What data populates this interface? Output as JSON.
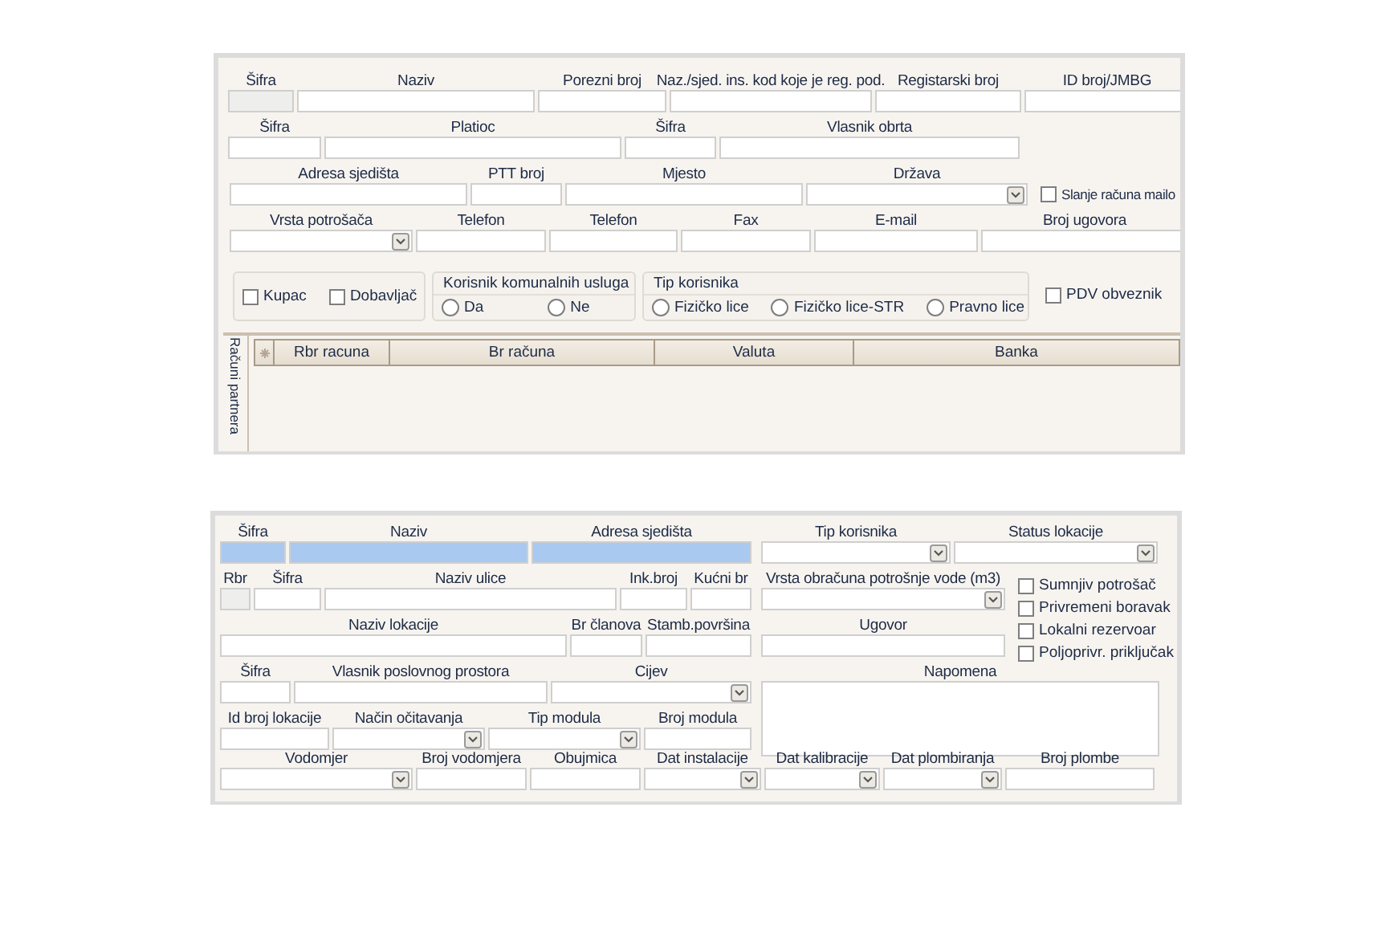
{
  "partner_form": {
    "lines": [
      {
        "fields": [
          {
            "kind": "text",
            "label": "Šifra",
            "disabled": true
          },
          {
            "kind": "text",
            "label": "Naziv",
            "disabled": false
          },
          {
            "kind": "text",
            "label": "Porezni broj",
            "disabled": false
          },
          {
            "kind": "text",
            "label": "Naz./sjed. ins. kod koje je reg. pod.",
            "disabled": false
          },
          {
            "kind": "text",
            "label": "Registarski broj",
            "disabled": false
          },
          {
            "kind": "text",
            "label": "ID broj/JMBG",
            "disabled": false
          }
        ]
      },
      {
        "fields": [
          {
            "kind": "text",
            "label": "Šifra",
            "disabled": false
          },
          {
            "kind": "text",
            "label": "Platioc",
            "disabled": false
          },
          {
            "kind": "text",
            "label": "Šifra",
            "disabled": false
          },
          {
            "kind": "text",
            "label": "Vlasnik obrta",
            "disabled": false
          }
        ]
      },
      {
        "fields": [
          {
            "kind": "text",
            "label": "Adresa sjedišta",
            "disabled": false
          },
          {
            "kind": "text",
            "label": "PTT broj",
            "disabled": false
          },
          {
            "kind": "text",
            "label": "Mjesto",
            "disabled": false
          },
          {
            "kind": "select",
            "label": "Država"
          }
        ],
        "checkbox": {
          "label": "Slanje računa mailo",
          "checked": false
        }
      },
      {
        "fields": [
          {
            "kind": "select",
            "label": "Vrsta potrošača"
          },
          {
            "kind": "text",
            "label": "Telefon",
            "disabled": false
          },
          {
            "kind": "text",
            "label": "Telefon",
            "disabled": false
          },
          {
            "kind": "text",
            "label": "Fax",
            "disabled": false
          },
          {
            "kind": "text",
            "label": "E-mail",
            "disabled": false
          },
          {
            "kind": "text",
            "label": "Broj ugovora",
            "disabled": false
          }
        ]
      }
    ],
    "roles": [
      {
        "label": "Kupac",
        "checked": false
      },
      {
        "label": "Dobavljač",
        "checked": false
      }
    ],
    "utility_user": {
      "title": "Korisnik komunalnih usluga",
      "options": [
        {
          "label": "Da",
          "selected": false
        },
        {
          "label": "Ne",
          "selected": false
        }
      ]
    },
    "user_type": {
      "title": "Tip korisnika",
      "options": [
        {
          "label": "Fizičko lice",
          "selected": false
        },
        {
          "label": "Fizičko lice-STR",
          "selected": false
        },
        {
          "label": "Pravno lice",
          "selected": false
        }
      ]
    },
    "vat": {
      "label": "PDV obveznik",
      "checked": false
    },
    "accounts": {
      "tab": "Računi partnera",
      "columns": [
        "Rbr racuna",
        "Br računa",
        "Valuta",
        "Banka"
      ]
    }
  },
  "location_form": {
    "left_lines": [
      {
        "fields": [
          {
            "kind": "text",
            "label": "Šifra",
            "disabled": false,
            "highlighted": true
          },
          {
            "kind": "text",
            "label": "Naziv",
            "disabled": false,
            "highlighted": true
          },
          {
            "kind": "text",
            "label": "Adresa sjedišta",
            "disabled": false,
            "highlighted": true
          }
        ]
      },
      {
        "fields": [
          {
            "kind": "text",
            "label": "Rbr",
            "disabled": true,
            "highlighted": false
          },
          {
            "kind": "text",
            "label": "Šifra",
            "disabled": false,
            "highlighted": false
          },
          {
            "kind": "text",
            "label": "Naziv ulice",
            "disabled": false,
            "highlighted": false
          },
          {
            "kind": "text",
            "label": "Ink.broj",
            "disabled": false,
            "highlighted": false
          },
          {
            "kind": "text",
            "label": "Kućni br",
            "disabled": false,
            "highlighted": false
          }
        ]
      },
      {
        "fields": [
          {
            "kind": "text",
            "label": "Naziv  lokacije",
            "disabled": false,
            "highlighted": false
          },
          {
            "kind": "text",
            "label": "Br članova",
            "disabled": false,
            "highlighted": false
          },
          {
            "kind": "text",
            "label": "Stamb.površina",
            "disabled": false,
            "highlighted": false
          }
        ]
      },
      {
        "fields": [
          {
            "kind": "text",
            "label": "Šifra",
            "disabled": false,
            "highlighted": false
          },
          {
            "kind": "text",
            "label": "Vlasnik poslovnog prostora",
            "disabled": false,
            "highlighted": false
          },
          {
            "kind": "select",
            "label": "Cijev"
          }
        ]
      },
      {
        "fields": [
          {
            "kind": "text",
            "label": "Id broj lokacije",
            "disabled": false,
            "highlighted": false
          },
          {
            "kind": "select",
            "label": "Način očitavanja"
          },
          {
            "kind": "select",
            "label": "Tip modula"
          },
          {
            "kind": "text",
            "label": "Broj modula",
            "disabled": false,
            "highlighted": false
          }
        ]
      }
    ],
    "right_top": [
      {
        "kind": "select",
        "label": "Tip korisnika"
      },
      {
        "kind": "select",
        "label": "Status lokacije"
      }
    ],
    "right_fields": [
      {
        "kind": "select",
        "label": "Vrsta obračuna potrošnje vode (m3)"
      },
      {
        "kind": "text",
        "label": "Ugovor",
        "disabled": false,
        "highlighted": false
      }
    ],
    "flags": [
      {
        "label": "Sumnjiv potrošač",
        "checked": false
      },
      {
        "label": "Privremeni boravak",
        "checked": false
      },
      {
        "label": "Lokalni rezervoar",
        "checked": false
      },
      {
        "label": "Poljoprivr. priključak",
        "checked": false
      }
    ],
    "note": {
      "label": "Napomena"
    },
    "bottom_fields": [
      {
        "kind": "select",
        "label": "Vodomjer"
      },
      {
        "kind": "text",
        "label": "Broj vodomjera",
        "disabled": false,
        "highlighted": false
      },
      {
        "kind": "text",
        "label": "Obujmica",
        "disabled": false,
        "highlighted": false
      },
      {
        "kind": "select",
        "label": "Dat instalacije"
      },
      {
        "kind": "select",
        "label": "Dat kalibracije"
      },
      {
        "kind": "select",
        "label": "Dat plombiranja"
      },
      {
        "kind": "text",
        "label": "Broj plombe",
        "disabled": false,
        "highlighted": false
      }
    ]
  }
}
